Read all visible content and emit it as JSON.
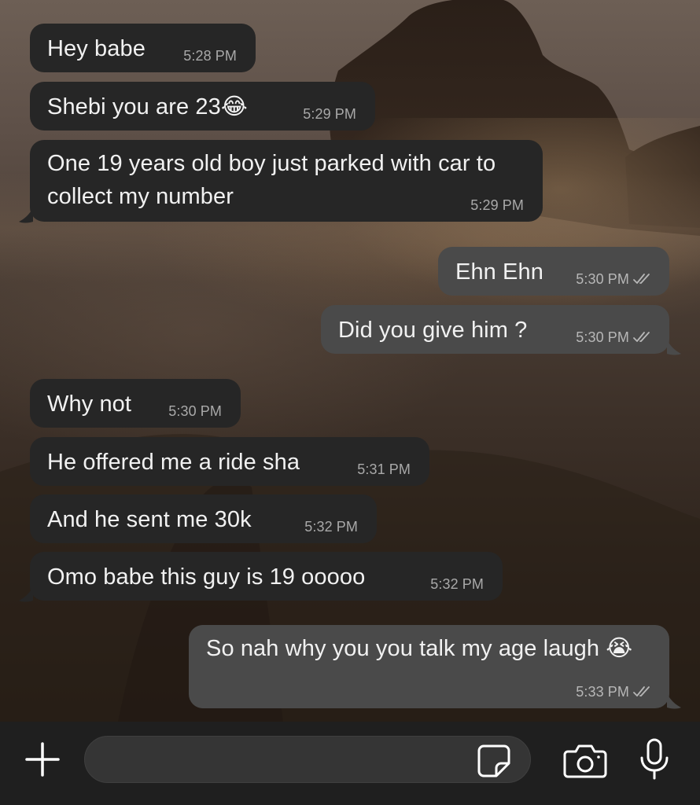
{
  "conversation": {
    "messages": [
      {
        "direction": "in",
        "text": "Hey babe",
        "time": "5:28 PM"
      },
      {
        "direction": "in",
        "text": "Shebi you are 23😂",
        "time": "5:29 PM"
      },
      {
        "direction": "in",
        "text": "One 19 years old boy just parked with car to collect my number",
        "time": "5:29 PM"
      },
      {
        "direction": "out",
        "text": "Ehn Ehn",
        "time": "5:30 PM",
        "status": "read"
      },
      {
        "direction": "out",
        "text": "Did you give him ?",
        "time": "5:30 PM",
        "status": "read"
      },
      {
        "direction": "in",
        "text": "Why not",
        "time": "5:30 PM"
      },
      {
        "direction": "in",
        "text": "He offered me a ride sha",
        "time": "5:31 PM"
      },
      {
        "direction": "in",
        "text": "And he sent me 30k",
        "time": "5:32 PM"
      },
      {
        "direction": "in",
        "text": "Omo babe this guy is 19 ooooo",
        "time": "5:32 PM"
      },
      {
        "direction": "out",
        "text": "So nah why you you talk my age laugh 😭",
        "time": "5:33 PM",
        "status": "read"
      }
    ]
  },
  "composer": {
    "value": "",
    "icons": {
      "attach": "plus-icon",
      "sticker": "sticker-icon",
      "camera": "camera-icon",
      "mic": "microphone-icon"
    }
  },
  "colors": {
    "incoming_bubble": "#262626",
    "outgoing_bubble": "#4a4a4a",
    "input_bar": "#1f1f1f",
    "timestamp": "#b7b7b7"
  }
}
